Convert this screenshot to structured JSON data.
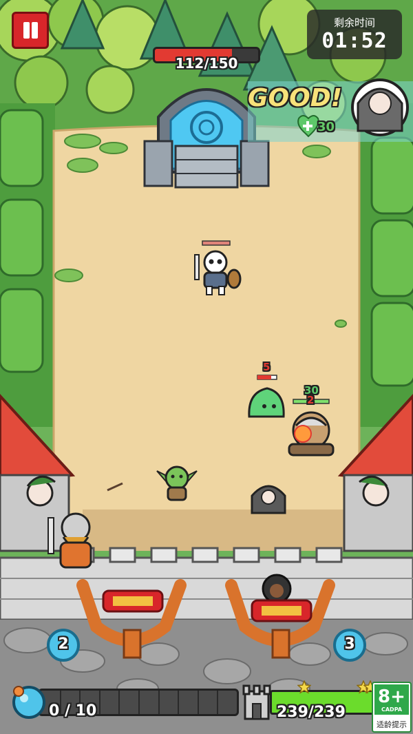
{
  "timer": {
    "label": "剩余时间",
    "value": "01:52"
  },
  "portal": {
    "hp_current": 112,
    "hp_max": 150,
    "hp_text": "112/150"
  },
  "combat_text": {
    "good": "GOOD!",
    "heal": "30"
  },
  "enemies": {
    "slime_damage": "5",
    "hit_damage_green": "30",
    "hit_damage_red": "2"
  },
  "slingshots": {
    "left_ammo": "2",
    "right_ammo": "3"
  },
  "mana": {
    "current": 0,
    "max": 10,
    "text": "0 / 10",
    "segments": 10
  },
  "castle": {
    "hp_current": 239,
    "hp_max": 239,
    "text": "239/239"
  },
  "rating": {
    "age": "8+",
    "org": "CADPA",
    "label": "适龄提示"
  },
  "colors": {
    "grass": "#6db35a",
    "dirt": "#efd6a2",
    "stone_wall": "#d9d9d9",
    "roof_red": "#e24b3b",
    "portal_blue": "#4fc8f2",
    "hp_red": "#e23a32",
    "castle_green": "#6bdc2c",
    "pause_red": "#d8262a"
  },
  "icons": {
    "pause": "pause-icon",
    "heal": "heart-plus-icon",
    "mana": "potion-orb-icon",
    "castle": "tower-icon",
    "star": "star-icon"
  }
}
